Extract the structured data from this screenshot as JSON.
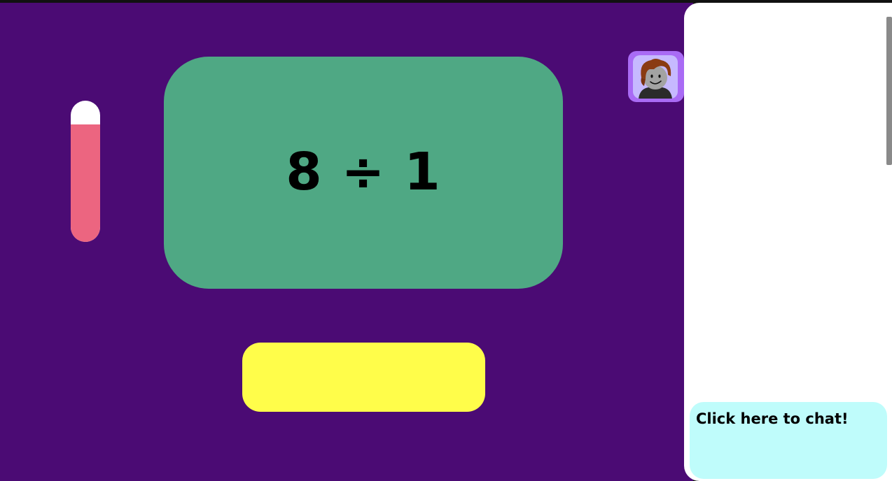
{
  "game": {
    "question": "8 ÷ 1",
    "answer_value": "",
    "timer_level": 0.83
  },
  "player": {
    "avatar_icon": "player-avatar-icon"
  },
  "chat": {
    "button_label": "Click here to chat!"
  },
  "colors": {
    "background": "#4b0b74",
    "question_card": "#4fa884",
    "answer_box": "#fffd4a",
    "timer_fill": "#ec6580",
    "timer_track": "#ffffff",
    "avatar_frame": "#a96bf5",
    "chat_button": "#bffcfb",
    "chat_panel": "#ffffff"
  }
}
